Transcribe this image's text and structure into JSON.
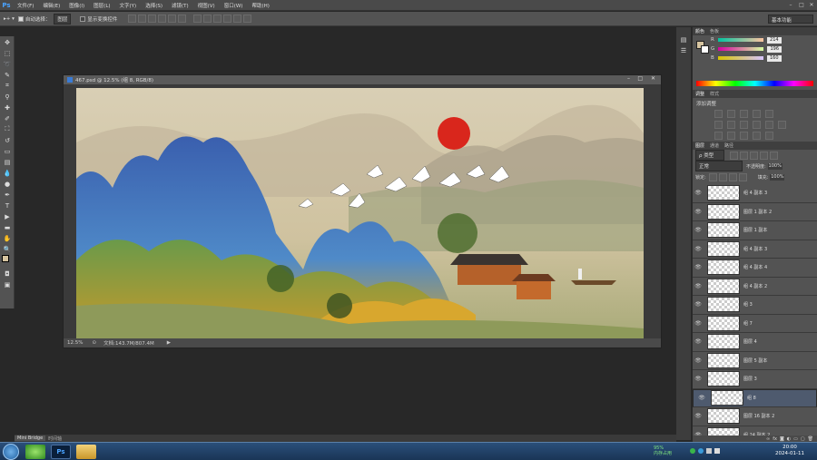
{
  "app": {
    "logo": "Ps",
    "minimize": "–",
    "maximize": "□",
    "close": "✕"
  },
  "menu": [
    "文件(F)",
    "编辑(E)",
    "图像(I)",
    "图层(L)",
    "文字(Y)",
    "选择(S)",
    "滤镜(T)",
    "视图(V)",
    "窗口(W)",
    "帮助(H)"
  ],
  "options": {
    "auto_select_label": "自动选择：",
    "auto_select_value": "图层",
    "show_transform_label": "显示变换控件",
    "workspace": "基本功能"
  },
  "document": {
    "title": "467.psd @ 12.5% (组 8, RGB/8)",
    "zoom": "12.5%",
    "doc_info": "文档:143.7M/807.4M"
  },
  "color_panel": {
    "tabs": [
      "颜色",
      "色板"
    ],
    "r_label": "R",
    "g_label": "G",
    "b_label": "B",
    "r": "214",
    "g": "196",
    "b": "160",
    "fg_color": "#d6c4a0",
    "bg_color": "#ffffff"
  },
  "adjustments": {
    "tabs": [
      "调整",
      "样式"
    ],
    "title": "添加调整"
  },
  "layers_panel": {
    "tabs": [
      "图层",
      "通道",
      "路径"
    ],
    "filter": "ρ 类型",
    "blend_mode": "正常",
    "opacity_label": "不透明度:",
    "opacity": "100%",
    "lock_label": "锁定:",
    "fill_label": "填充:",
    "fill": "100%",
    "layers": [
      {
        "name": "组 4 副本 3",
        "selected": false
      },
      {
        "name": "图层 1 副本 2",
        "selected": false
      },
      {
        "name": "图层 1 副本",
        "selected": false
      },
      {
        "name": "组 4 副本 3",
        "selected": false
      },
      {
        "name": "组 4 副本 4",
        "selected": false
      },
      {
        "name": "组 4 副本 2",
        "selected": false
      },
      {
        "name": "组 3",
        "selected": false
      },
      {
        "name": "组 7",
        "selected": false
      },
      {
        "name": "图层 4",
        "selected": false
      },
      {
        "name": "图层 5 副本",
        "selected": false
      },
      {
        "name": "图层 3",
        "selected": false
      },
      {
        "name": "组 8",
        "selected": true
      },
      {
        "name": "图层 16 副本 2",
        "selected": false
      },
      {
        "name": "组 24 副本 2",
        "selected": false
      }
    ]
  },
  "bottom_tabs": [
    "Mini Bridge",
    "时间轴"
  ],
  "taskbar": {
    "ps_label": "Ps",
    "time": "20:00",
    "date": "2024-01-11",
    "tray_percent": "95%",
    "tray_label": "内存占用"
  }
}
